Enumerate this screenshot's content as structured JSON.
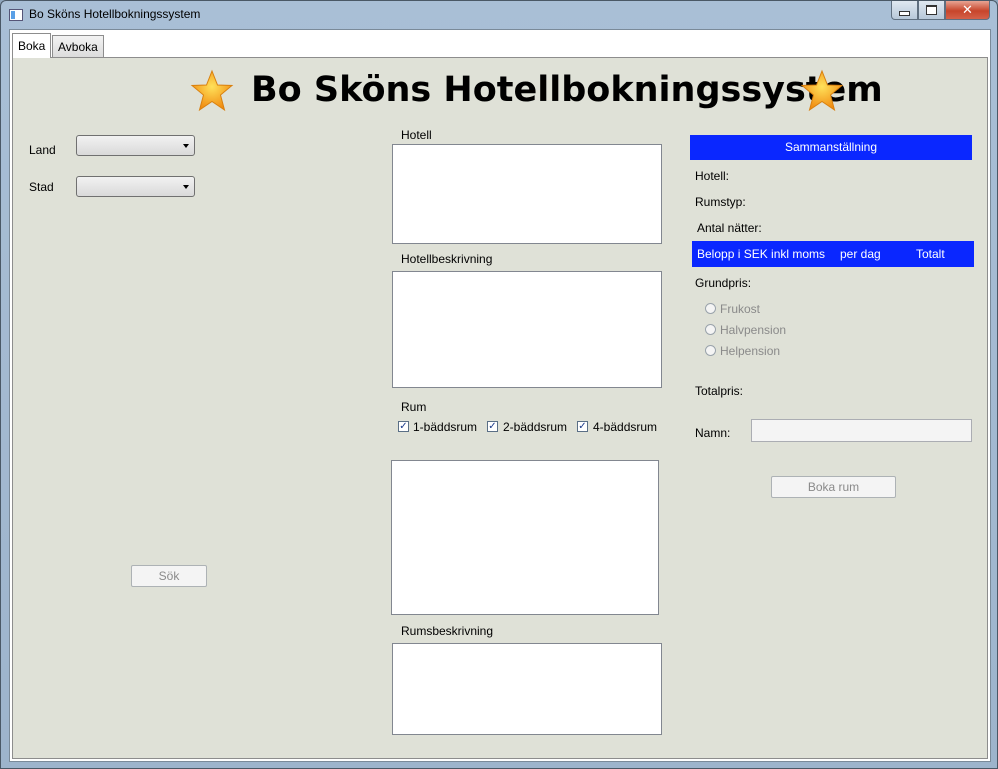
{
  "window": {
    "title": "Bo Sköns Hotellbokningssystem",
    "close_glyph": "✕"
  },
  "tabs": [
    {
      "label": "Boka"
    },
    {
      "label": "Avboka"
    }
  ],
  "heading": {
    "title": "Bo Sköns Hotellbokningssystem",
    "icon": "star-icon"
  },
  "search": {
    "country_label": "Land",
    "city_label": "Stad",
    "search_button": "Sök"
  },
  "hotel": {
    "hotel_label": "Hotell",
    "description_label": "Hotellbeskrivning",
    "room_label": "Rum",
    "room_types": [
      {
        "label": "1-bäddsrum",
        "checked": true
      },
      {
        "label": "2-bäddsrum",
        "checked": true
      },
      {
        "label": "4-bäddsrum",
        "checked": true
      }
    ],
    "room_description_label": "Rumsbeskrivning",
    "check_glyph": "✓"
  },
  "summary": {
    "header": "Sammanställning",
    "hotel_label": "Hotell:",
    "room_type_label": "Rumstyp:",
    "nights_label": "Antal nätter:",
    "price_band": {
      "amount_label": "Belopp i SEK inkl moms",
      "per_day_label": "per dag",
      "total_label": "Totalt"
    },
    "base_price_label": "Grundpris:",
    "meal_options": [
      {
        "label": "Frukost"
      },
      {
        "label": "Halvpension"
      },
      {
        "label": "Helpension"
      }
    ],
    "total_price_label": "Totalpris:",
    "name_label": "Namn:",
    "name_value": "",
    "book_button": "Boka rum"
  },
  "colors": {
    "accent_band": "#0a27ff",
    "content_bg": "#dfe1d7",
    "star": "#f7a21b"
  }
}
